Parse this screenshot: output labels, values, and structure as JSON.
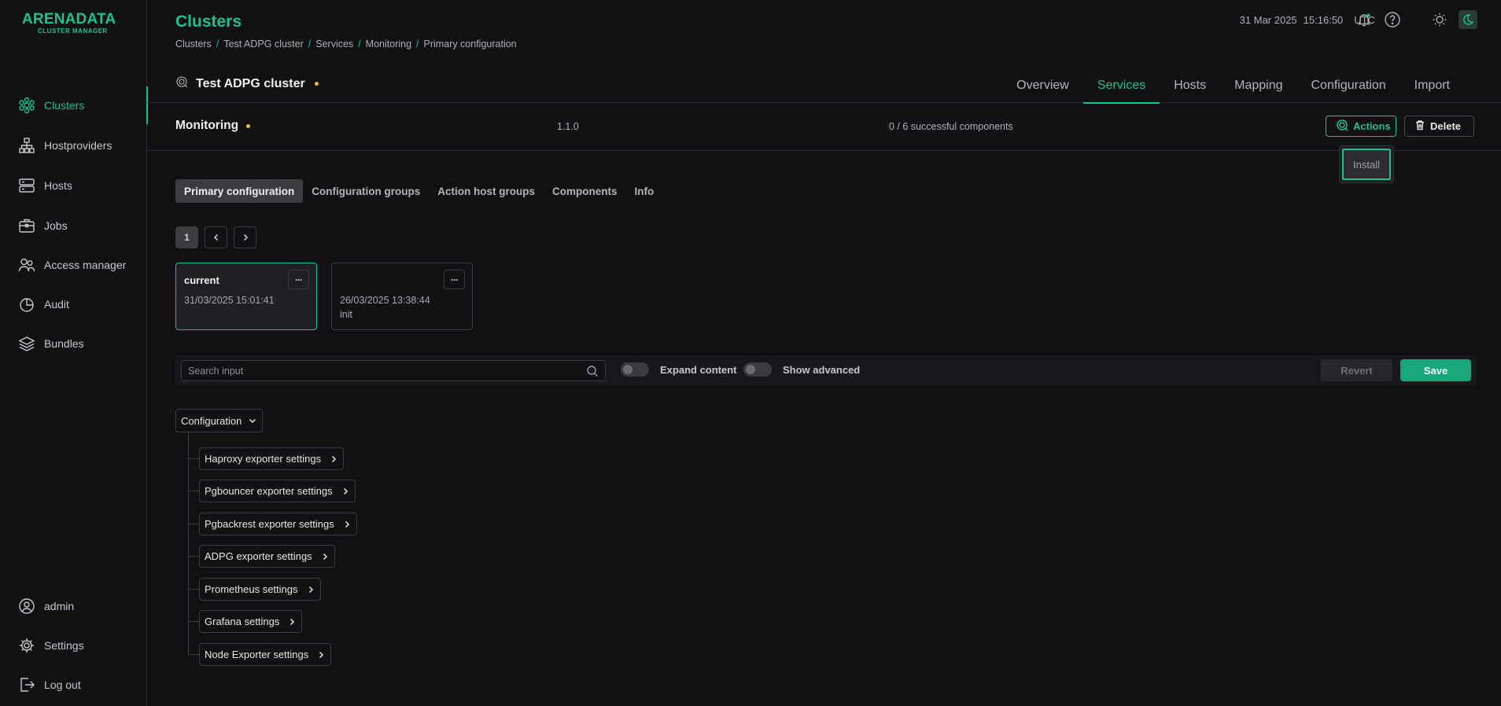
{
  "brand": {
    "name": "ARENADATA",
    "sub": "CLUSTER MANAGER"
  },
  "sidebar": {
    "items": [
      {
        "label": "Clusters",
        "icon": "clusters-icon"
      },
      {
        "label": "Hostproviders",
        "icon": "hostproviders-icon"
      },
      {
        "label": "Hosts",
        "icon": "hosts-icon"
      },
      {
        "label": "Jobs",
        "icon": "jobs-icon"
      },
      {
        "label": "Access manager",
        "icon": "access-manager-icon"
      },
      {
        "label": "Audit",
        "icon": "audit-icon"
      },
      {
        "label": "Bundles",
        "icon": "bundles-icon"
      }
    ],
    "bottom": [
      {
        "label": "admin",
        "icon": "user-icon"
      },
      {
        "label": "Settings",
        "icon": "gear-icon"
      },
      {
        "label": "Log out",
        "icon": "logout-icon"
      }
    ]
  },
  "header": {
    "title": "Clusters",
    "breadcrumb": [
      "Clusters",
      "Test ADPG cluster",
      "Services",
      "Monitoring",
      "Primary configuration"
    ],
    "date": "31 Mar 2025",
    "time": "15:16:50",
    "tz": "UTC"
  },
  "cluster": {
    "name": "Test ADPG cluster",
    "tabs": [
      "Overview",
      "Services",
      "Hosts",
      "Mapping",
      "Configuration",
      "Import"
    ],
    "active_tab": "Services"
  },
  "service": {
    "name": "Monitoring",
    "version": "1.1.0",
    "status": "0 / 6 successful components",
    "actions_label": "Actions",
    "delete_label": "Delete",
    "dropdown_item": "Install"
  },
  "subtabs": [
    "Primary configuration",
    "Configuration groups",
    "Action host groups",
    "Components",
    "Info"
  ],
  "pager": {
    "page": "1"
  },
  "configs": [
    {
      "title": "current",
      "date": "31/03/2025 15:01:41",
      "desc": ""
    },
    {
      "title": "",
      "date": "26/03/2025 13:38:44",
      "desc": "init"
    }
  ],
  "toolbar": {
    "search_placeholder": "Search input",
    "expand_label": "Expand content",
    "advanced_label": "Show advanced",
    "revert_label": "Revert",
    "save_label": "Save"
  },
  "tree": {
    "root": "Configuration",
    "nodes": [
      "Haproxy exporter settings",
      "Pgbouncer exporter settings",
      "Pgbackrest exporter settings",
      "ADPG exporter settings",
      "Prometheus settings",
      "Grafana settings",
      "Node Exporter settings"
    ]
  },
  "colors": {
    "accent": "#1dc08f",
    "background": "#111114",
    "warning_dot": "#f0c030"
  }
}
